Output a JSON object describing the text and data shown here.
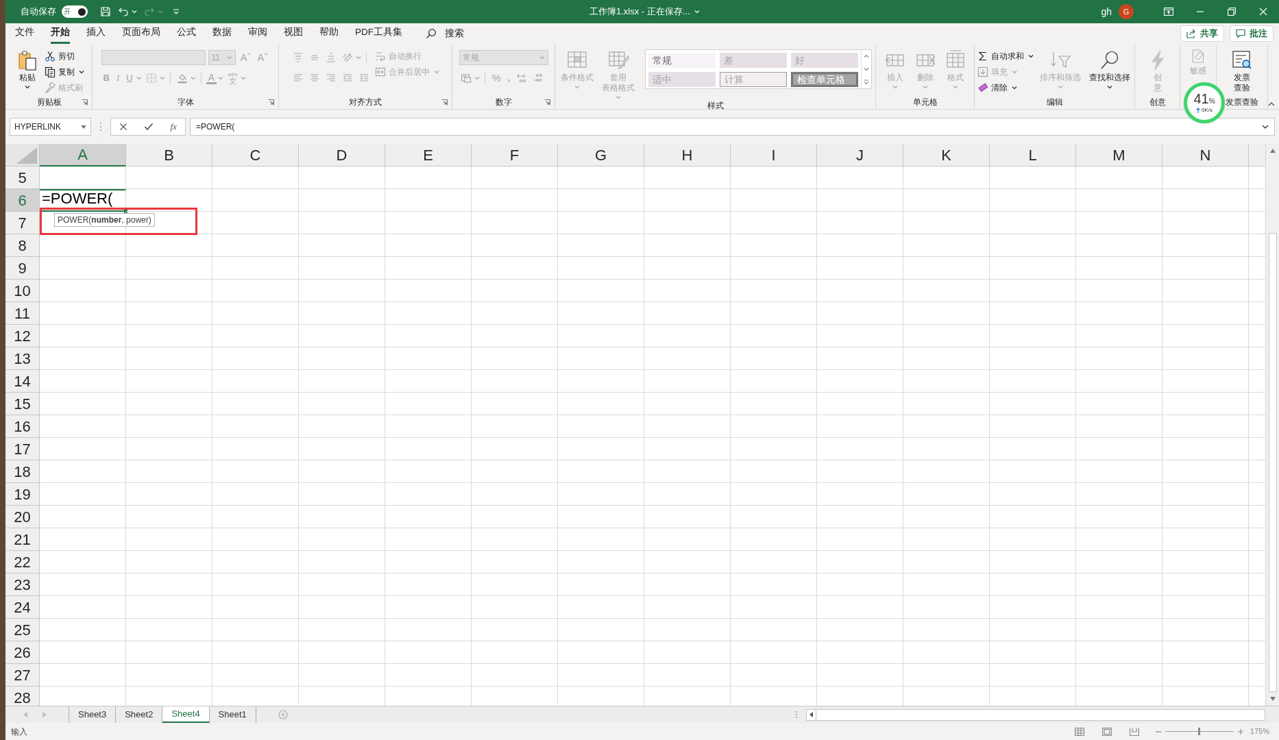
{
  "title_bar": {
    "autosave_label": "自动保存",
    "autosave": {
      "text": "开",
      "on": true
    },
    "title": "工作簿1.xlsx - 正在保存...",
    "user": "gh",
    "avatar": "G"
  },
  "menu_tabs": [
    {
      "label": "文件",
      "selected": false
    },
    {
      "label": "开始",
      "selected": true
    },
    {
      "label": "插入",
      "selected": false
    },
    {
      "label": "页面布局",
      "selected": false
    },
    {
      "label": "公式",
      "selected": false
    },
    {
      "label": "数据",
      "selected": false
    },
    {
      "label": "审阅",
      "selected": false
    },
    {
      "label": "视图",
      "selected": false
    },
    {
      "label": "帮助",
      "selected": false
    },
    {
      "label": "PDF工具集",
      "selected": false
    }
  ],
  "search": {
    "label": "搜索"
  },
  "share_button": "共享",
  "comments_button": "批注",
  "ribbon_groups": [
    {
      "label": "剪贴板",
      "launcher": true,
      "columns": [
        [
          {
            "kind": "large",
            "label": "粘贴",
            "dropdown": true,
            "disabled": false
          }
        ],
        [
          {
            "kind": "small",
            "label": "剪切",
            "dropdown": false,
            "disabled": false
          },
          {
            "kind": "small",
            "label": "复制",
            "dropdown": true,
            "disabled": false
          },
          {
            "kind": "small",
            "label": "格式刷",
            "dropdown": false,
            "disabled": true
          }
        ]
      ]
    },
    {
      "label": "字体",
      "launcher": true,
      "columns": [
        [
          {
            "kind": "toolbar",
            "disabled": true,
            "buttons": [
              {
                "kind": "field"
              },
              {
                "kind": "field",
                "value": "11",
                "dropdown": true
              },
              {
                "kind": "text",
                "text": "Aˆ"
              },
              {
                "kind": "text",
                "text": "Aˇ"
              }
            ]
          },
          {
            "kind": "toolbar",
            "disabled": true,
            "buttons": [
              {
                "kind": "bold",
                "text": "B"
              },
              {
                "kind": "italic",
                "text": "I"
              },
              {
                "kind": "underline",
                "text": "U",
                "dropdown": true
              },
              {
                "kind": "icon",
                "dropdown": true
              },
              {
                "kind": "icon",
                "dropdown": true
              },
              {
                "kind": "color-text",
                "text": "A",
                "dropdown": true
              },
              {
                "kind": "phonetic",
                "top": "wén",
                "bottom": "文",
                "dropdown": true
              }
            ]
          }
        ]
      ]
    },
    {
      "label": "对齐方式",
      "launcher": true,
      "columns": [
        [
          {
            "kind": "toolbar",
            "disabled": true,
            "buttons": [
              {
                "kind": "icon"
              },
              {
                "kind": "icon"
              },
              {
                "kind": "icon"
              },
              {
                "kind": "icon",
                "dropdown": true
              }
            ]
          },
          {
            "kind": "toolbar",
            "disabled": true,
            "buttons": [
              {
                "kind": "icon"
              },
              {
                "kind": "icon"
              },
              {
                "kind": "icon"
              },
              {
                "kind": "icon"
              },
              {
                "kind": "icon"
              }
            ]
          }
        ],
        [
          {
            "kind": "small",
            "label": "自动换行",
            "dropdown": false,
            "disabled": true
          },
          {
            "kind": "small",
            "label": "合并后居中",
            "dropdown": true,
            "disabled": true
          }
        ]
      ]
    },
    {
      "label": "数字",
      "launcher": true,
      "columns": [
        [
          {
            "kind": "toolbar",
            "disabled": true,
            "buttons": [
              {
                "kind": "field",
                "value": "常规",
                "dropdown": true
              }
            ]
          },
          {
            "kind": "toolbar",
            "disabled": true,
            "buttons": [
              {
                "kind": "icon",
                "dropdown": true
              },
              {
                "kind": "text",
                "text": "%"
              },
              {
                "kind": "bold",
                "text": ","
              },
              {
                "kind": "icon"
              },
              {
                "kind": "icon"
              }
            ]
          }
        ]
      ]
    },
    {
      "label": "样式",
      "launcher": false,
      "columns": [
        [
          {
            "kind": "large",
            "label": "条件格式",
            "dropdown": true,
            "disabled": true
          }
        ],
        [
          {
            "kind": "large",
            "label": "套用表格格式",
            "dropdown": true,
            "disabled": true
          }
        ],
        [
          {
            "kind": "gallery",
            "cells": [
              {
                "kind": "normal",
                "label": "常规"
              },
              {
                "kind": "bad",
                "label": "差"
              },
              {
                "kind": "good",
                "label": "好"
              },
              {
                "kind": "neutral",
                "label": "适中"
              },
              {
                "kind": "calculation",
                "label": "计算"
              },
              {
                "kind": "check",
                "label": "检查单元格"
              }
            ]
          }
        ]
      ]
    },
    {
      "label": "单元格",
      "launcher": false,
      "columns": [
        [
          {
            "kind": "large",
            "label": "插入",
            "dropdown": true,
            "disabled": true
          }
        ],
        [
          {
            "kind": "large",
            "label": "删除",
            "dropdown": true,
            "disabled": true
          }
        ],
        [
          {
            "kind": "large",
            "label": "格式",
            "dropdown": true,
            "disabled": true
          }
        ]
      ]
    },
    {
      "label": "编辑",
      "launcher": false,
      "columns": [
        [
          {
            "kind": "small",
            "label": "自动求和",
            "dropdown": true,
            "disabled": false
          },
          {
            "kind": "small",
            "label": "填充",
            "dropdown": true,
            "disabled": true
          },
          {
            "kind": "small",
            "label": "清除",
            "dropdown": true,
            "disabled": false
          }
        ],
        [
          {
            "kind": "large",
            "label": "排序和筛选",
            "dropdown": true,
            "disabled": true
          }
        ],
        [
          {
            "kind": "large",
            "label": "查找和选择",
            "dropdown": true,
            "disabled": false
          }
        ]
      ]
    },
    {
      "label": "创意",
      "launcher": false,
      "columns": [
        [
          {
            "kind": "large",
            "label": "创意",
            "dropdown": false,
            "disabled": true
          }
        ]
      ]
    },
    {
      "launcher": false,
      "columns": [
        [
          {
            "kind": "large",
            "label": "敏感",
            "dropdown": false,
            "disabled": true
          }
        ]
      ]
    },
    {
      "label": "发票查验",
      "launcher": false,
      "columns": [
        [
          {
            "kind": "large",
            "label": "发票查验",
            "dropdown": false,
            "disabled": false
          }
        ]
      ]
    }
  ],
  "formula_bar": {
    "name_box": "HYPERLINK",
    "function_button": "fx",
    "formula": "=POWER("
  },
  "columns": [
    {
      "label": "A",
      "selected": true
    },
    {
      "label": "B",
      "selected": false
    },
    {
      "label": "C",
      "selected": false
    },
    {
      "label": "D",
      "selected": false
    },
    {
      "label": "E",
      "selected": false
    },
    {
      "label": "F",
      "selected": false
    },
    {
      "label": "G",
      "selected": false
    },
    {
      "label": "H",
      "selected": false
    },
    {
      "label": "I",
      "selected": false
    },
    {
      "label": "J",
      "selected": false
    },
    {
      "label": "K",
      "selected": false
    },
    {
      "label": "L",
      "selected": false
    },
    {
      "label": "M",
      "selected": false
    },
    {
      "label": "N",
      "selected": false
    }
  ],
  "rows": [
    {
      "label": "5",
      "selected": false
    },
    {
      "label": "6",
      "selected": true
    },
    {
      "label": "7",
      "selected": false
    },
    {
      "label": "8",
      "selected": false
    },
    {
      "label": "9",
      "selected": false
    },
    {
      "label": "10",
      "selected": false
    },
    {
      "label": "11",
      "selected": false
    },
    {
      "label": "12",
      "selected": false
    },
    {
      "label": "13",
      "selected": false
    },
    {
      "label": "14",
      "selected": false
    },
    {
      "label": "15",
      "selected": false
    },
    {
      "label": "16",
      "selected": false
    },
    {
      "label": "17",
      "selected": false
    },
    {
      "label": "18",
      "selected": false
    },
    {
      "label": "19",
      "selected": false
    },
    {
      "label": "20",
      "selected": false
    },
    {
      "label": "21",
      "selected": false
    },
    {
      "label": "22",
      "selected": false
    },
    {
      "label": "23",
      "selected": false
    },
    {
      "label": "24",
      "selected": false
    },
    {
      "label": "25",
      "selected": false
    },
    {
      "label": "26",
      "selected": false
    },
    {
      "label": "27",
      "selected": false
    },
    {
      "label": "28",
      "selected": false
    }
  ],
  "active_cell": {
    "text": "=POWER("
  },
  "tooltip": "POWER(**number**, power)",
  "sheet_tabs": [
    {
      "label": "Sheet3",
      "selected": false
    },
    {
      "label": "Sheet2",
      "selected": false
    },
    {
      "label": "Sheet4",
      "selected": true
    },
    {
      "label": "Sheet1",
      "selected": false
    }
  ],
  "status_bar": {
    "mode": "输入",
    "zoom": {
      "level": 0.5,
      "label": "175%"
    }
  },
  "network_widget": {
    "percent": "41",
    "unit": "%",
    "speed": "0K/s"
  }
}
